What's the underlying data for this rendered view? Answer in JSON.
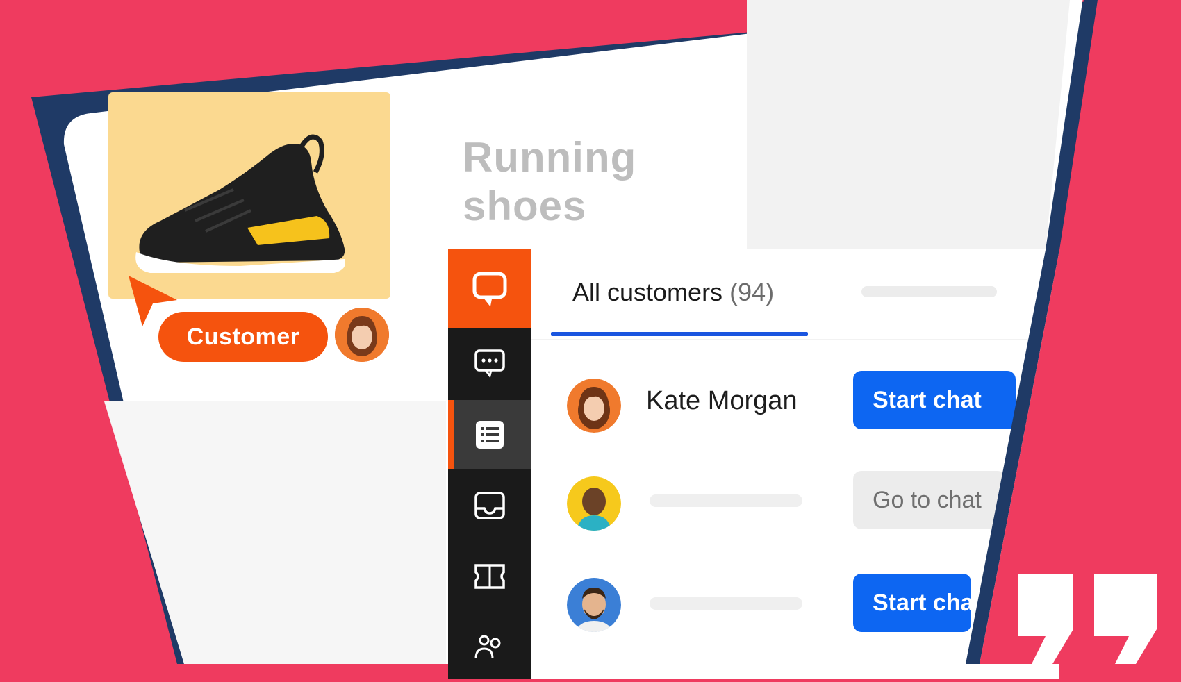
{
  "product": {
    "title_line1": "Running",
    "title_line2": "shoes"
  },
  "customer_badge": {
    "label": "Customer"
  },
  "sidebar": {
    "items": [
      {
        "icon": "chat-bubble-icon",
        "active": false,
        "highlight": true
      },
      {
        "icon": "message-icon",
        "active": false
      },
      {
        "icon": "list-icon",
        "active": true
      },
      {
        "icon": "inbox-icon",
        "active": false
      },
      {
        "icon": "ticket-icon",
        "active": false
      },
      {
        "icon": "team-icon",
        "active": false
      }
    ]
  },
  "customers": {
    "tab_label": "All customers",
    "tab_count": "(94)",
    "rows": [
      {
        "name": "Kate Morgan",
        "action": "Start chat"
      },
      {
        "name": "",
        "action": "Go to chat"
      },
      {
        "name": "",
        "action": "Start chat"
      }
    ]
  },
  "colors": {
    "background": "#ef3b5f",
    "frame": "#1f3a66",
    "accent_orange": "#f5530e",
    "primary_blue": "#0d66f2",
    "product_card": "#fbd990"
  }
}
